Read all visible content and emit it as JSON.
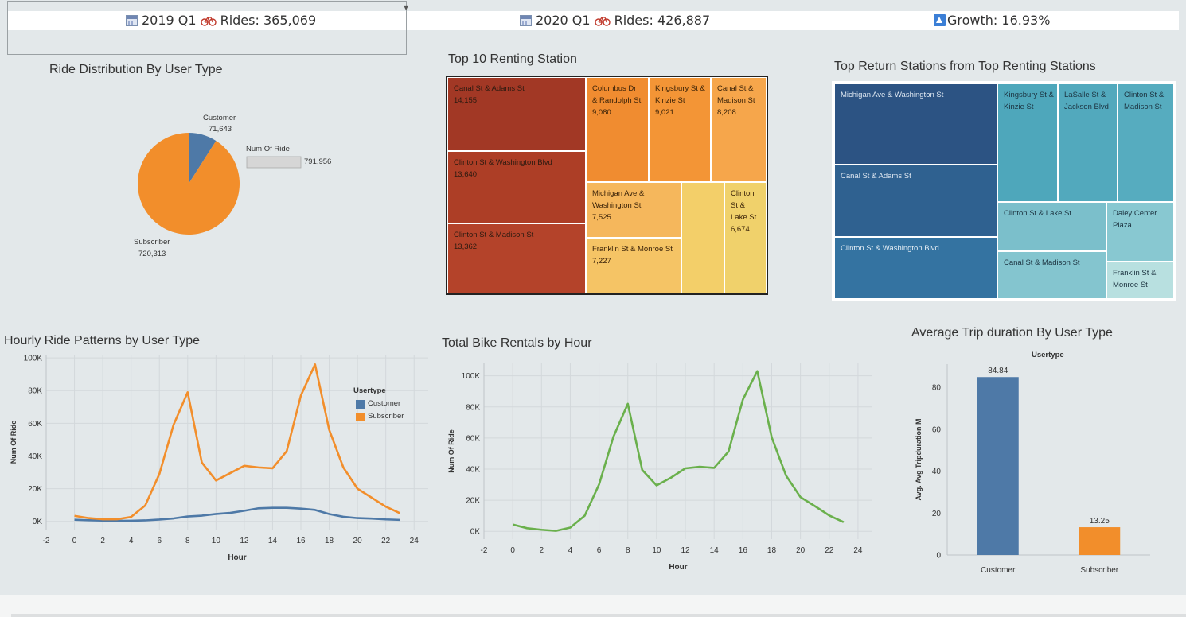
{
  "kpi": {
    "k2019": {
      "period": "2019 Q1",
      "rides": "Rides: 365,069"
    },
    "k2020": {
      "period": "2020 Q1",
      "rides": "Rides: 426,887"
    },
    "growth": "Growth: 16.93%"
  },
  "colors": {
    "customer": "#4e79a7",
    "subscriber": "#f28e2b",
    "total": "#6ab04c"
  },
  "chart_data": [
    {
      "id": "pie",
      "type": "pie",
      "title": "Ride Distribution By User Type",
      "slices": [
        {
          "label": "Customer",
          "value_text": "71,643",
          "value": 71643
        },
        {
          "label": "Subscriber",
          "value_text": "720,313",
          "value": 720313
        }
      ],
      "size_legend": {
        "title": "Num Of Ride",
        "value": "791,956"
      }
    },
    {
      "id": "renting",
      "type": "treemap",
      "title": "Top 10 Renting Station",
      "items": [
        {
          "label": "Canal St & Adams St",
          "value": "14,155"
        },
        {
          "label": "Clinton St & Washington Blvd",
          "value": "13,640"
        },
        {
          "label": "Clinton St & Madison St",
          "value": "13,362"
        },
        {
          "label": "Columbus Dr & Randolph St",
          "value": "9,080"
        },
        {
          "label": "Kingsbury St & Kinzie St",
          "value": "9,021"
        },
        {
          "label": "Canal St & Madison St",
          "value": "8,208"
        },
        {
          "label": "Michigan Ave & Washington St",
          "value": "7,525"
        },
        {
          "label": "Franklin St & Monroe St",
          "value": "7,227"
        },
        {
          "label": "Clinton St & Lake St",
          "value": "6,674"
        },
        {
          "label": "",
          "value": ""
        }
      ]
    },
    {
      "id": "returns",
      "type": "treemap",
      "title": "Top Return Stations from Top Renting Stations",
      "items": [
        {
          "label": "Michigan Ave & Washington St"
        },
        {
          "label": "Canal St & Adams St"
        },
        {
          "label": "Clinton St & Washington Blvd"
        },
        {
          "label": "Kingsbury St & Kinzie St"
        },
        {
          "label": "LaSalle St & Jackson Blvd"
        },
        {
          "label": "Clinton St & Madison St"
        },
        {
          "label": "Clinton St & Lake St"
        },
        {
          "label": "Daley Center Plaza"
        },
        {
          "label": "Canal St & Madison St"
        },
        {
          "label": "Franklin St & Monroe St"
        }
      ]
    },
    {
      "id": "hourly",
      "type": "line",
      "title": "Hourly Ride Patterns by User Type",
      "xlabel": "Hour",
      "ylabel": "Num Of Ride",
      "xlim": [
        -2,
        25
      ],
      "ylim": [
        -5000,
        102000
      ],
      "x_ticks": [
        -2,
        0,
        2,
        4,
        6,
        8,
        10,
        12,
        14,
        16,
        18,
        20,
        22,
        24
      ],
      "y_ticks": [
        {
          "v": 0,
          "t": "0K"
        },
        {
          "v": 20000,
          "t": "20K"
        },
        {
          "v": 40000,
          "t": "40K"
        },
        {
          "v": 60000,
          "t": "60K"
        },
        {
          "v": 80000,
          "t": "80K"
        },
        {
          "v": 100000,
          "t": "100K"
        }
      ],
      "x": [
        0,
        1,
        2,
        3,
        4,
        5,
        6,
        7,
        8,
        9,
        10,
        11,
        12,
        13,
        14,
        15,
        16,
        17,
        18,
        19,
        20,
        21,
        22,
        23
      ],
      "legend_title": "Usertype",
      "series": [
        {
          "name": "Customer",
          "color": "#4e79a7",
          "values": [
            1000,
            700,
            500,
            300,
            400,
            600,
            1100,
            1800,
            3000,
            3500,
            4500,
            5200,
            6500,
            8000,
            8300,
            8300,
            7800,
            7000,
            4500,
            2800,
            2000,
            1700,
            1200,
            900
          ]
        },
        {
          "name": "Subscriber",
          "color": "#f28e2b",
          "values": [
            3400,
            2000,
            1300,
            1300,
            2700,
            9700,
            29000,
            59000,
            79000,
            36000,
            25000,
            29500,
            34000,
            33000,
            32500,
            43000,
            77000,
            96000,
            56000,
            33000,
            20000,
            14500,
            9000,
            5000
          ]
        }
      ]
    },
    {
      "id": "total",
      "type": "line",
      "title": "Total Bike Rentals by Hour",
      "xlabel": "Hour",
      "ylabel": "Num Of Ride",
      "xlim": [
        -2,
        25
      ],
      "ylim": [
        -5000,
        108000
      ],
      "x_ticks": [
        -2,
        0,
        2,
        4,
        6,
        8,
        10,
        12,
        14,
        16,
        18,
        20,
        22,
        24
      ],
      "y_ticks": [
        {
          "v": 0,
          "t": "0K"
        },
        {
          "v": 20000,
          "t": "20K"
        },
        {
          "v": 40000,
          "t": "40K"
        },
        {
          "v": 60000,
          "t": "60K"
        },
        {
          "v": 80000,
          "t": "80K"
        },
        {
          "v": 100000,
          "t": "100K"
        }
      ],
      "x": [
        0,
        1,
        2,
        3,
        4,
        5,
        6,
        7,
        8,
        9,
        10,
        11,
        12,
        13,
        14,
        15,
        16,
        17,
        18,
        19,
        20,
        21,
        22,
        23
      ],
      "series": [
        {
          "name": "",
          "color": "#6ab04c",
          "values": [
            4400,
            2000,
            1000,
            300,
            2400,
            10000,
            30100,
            60800,
            82000,
            39500,
            29500,
            34500,
            40500,
            41500,
            40800,
            51300,
            84800,
            103000,
            60500,
            35800,
            22000,
            16200,
            10200,
            5900
          ]
        }
      ]
    },
    {
      "id": "duration",
      "type": "bar",
      "title": "Average Trip duration By User Type",
      "header": "Usertype",
      "ylabel": "Avg. Avg Tripduration M",
      "ylim": [
        0,
        91
      ],
      "y_ticks": [
        0,
        20,
        40,
        60,
        80
      ],
      "categories": [
        "Customer",
        "Subscriber"
      ],
      "values": [
        84.84,
        13.25
      ],
      "value_labels": [
        "84.84",
        "13.25"
      ],
      "colors": [
        "#4e79a7",
        "#f28e2b"
      ]
    }
  ]
}
